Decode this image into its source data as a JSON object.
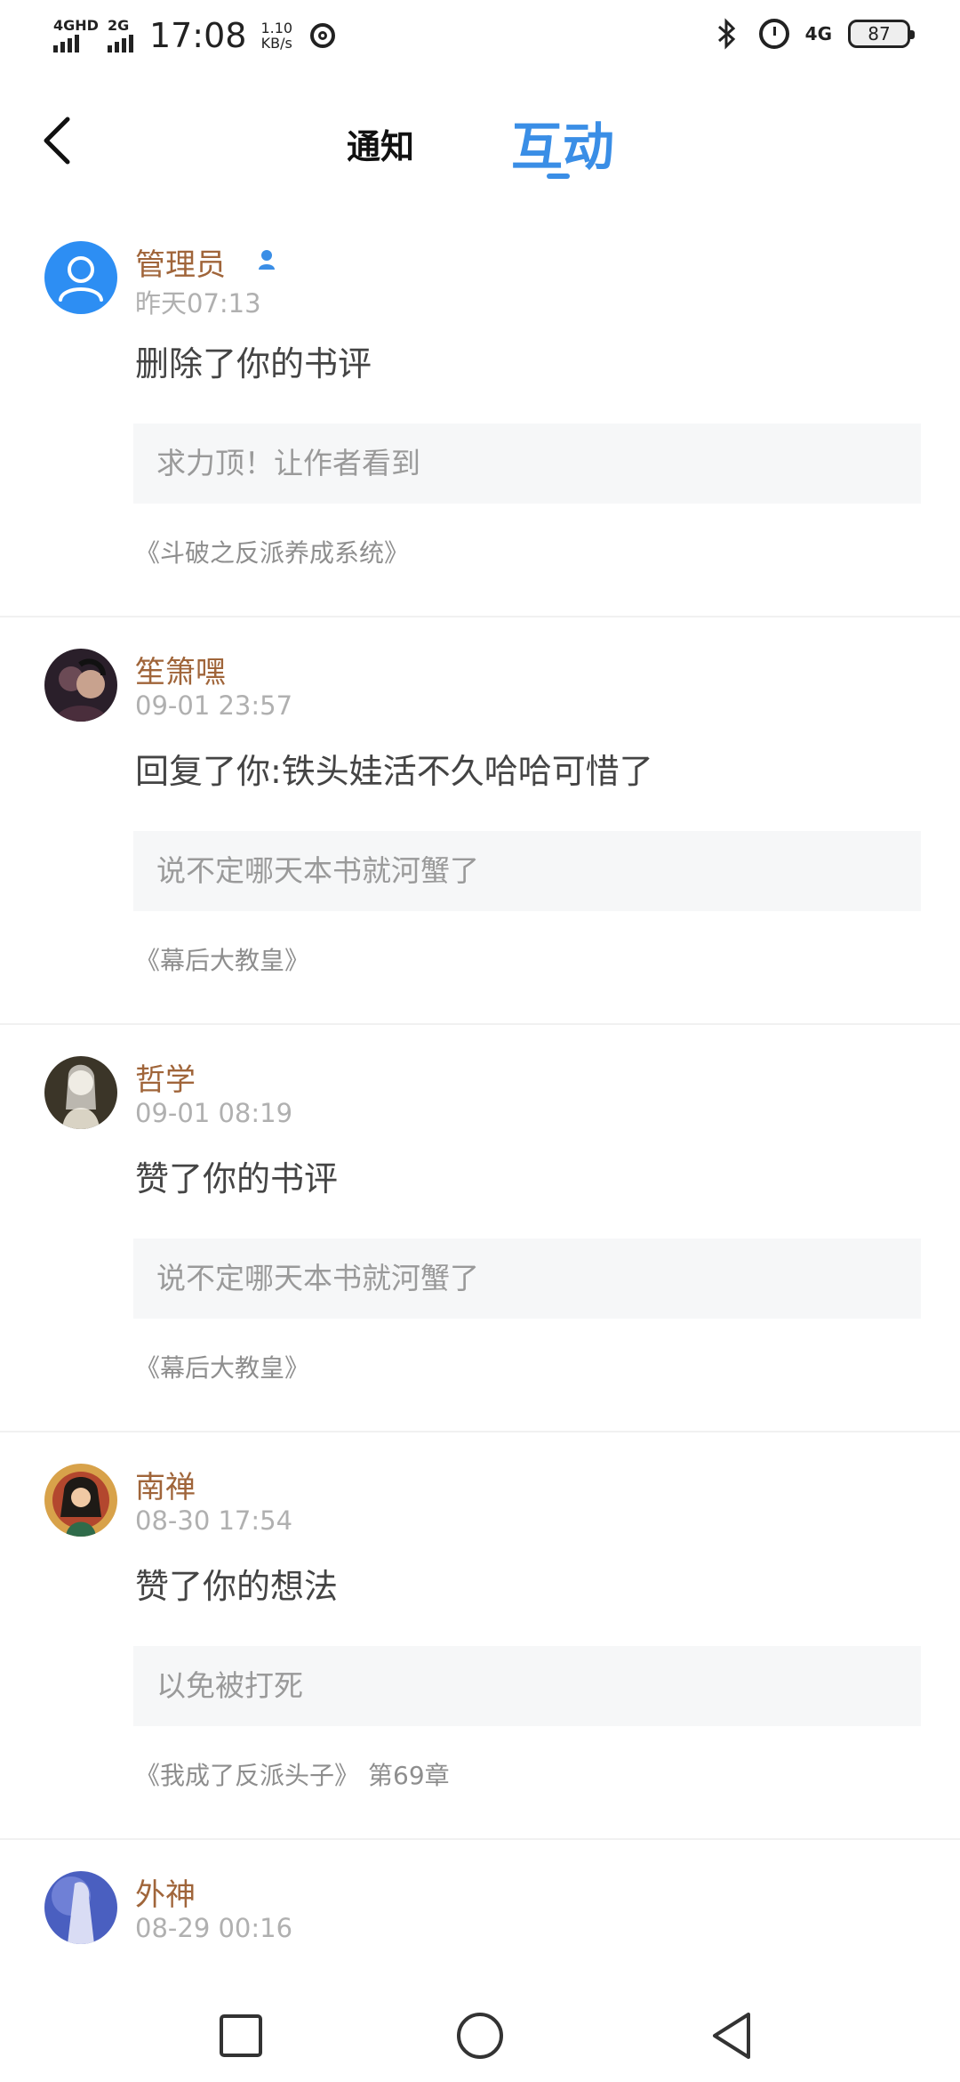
{
  "status_bar": {
    "net_left_1": "4GHD",
    "net_left_2": "2G",
    "time": "17:08",
    "speed_value": "1.10",
    "speed_unit": "KB/s",
    "net_right": "4G",
    "battery": "87",
    "icons": [
      "signal-icon",
      "app-notification-icon",
      "bluetooth-icon",
      "alarm-icon",
      "battery-icon"
    ]
  },
  "header": {
    "back_icon": "chevron-left-icon",
    "tab_notify": "通知",
    "tab_interact": "互动",
    "active_tab": "互动",
    "accent_color": "#3a8ee6"
  },
  "feed": [
    {
      "username": "管理员",
      "verified": true,
      "time": "昨天07:13",
      "action": "删除了你的书评",
      "quote": "求力顶！让作者看到",
      "book": "《斗破之反派养成系统》",
      "chapter": ""
    },
    {
      "username": "笙箫嘿",
      "verified": false,
      "time": "09-01 23:57",
      "action": "回复了你:铁头娃活不久哈哈可惜了",
      "quote": "说不定哪天本书就河蟹了",
      "book": "《幕后大教皇》",
      "chapter": ""
    },
    {
      "username": "哲学",
      "verified": false,
      "time": "09-01 08:19",
      "action": "赞了你的书评",
      "quote": "说不定哪天本书就河蟹了",
      "book": "《幕后大教皇》",
      "chapter": ""
    },
    {
      "username": "南禅",
      "verified": false,
      "time": "08-30 17:54",
      "action": "赞了你的想法",
      "quote": "以免被打死",
      "book": "《我成了反派头子》",
      "chapter": "第69章"
    },
    {
      "username": "外神",
      "verified": false,
      "time": "08-29 00:16"
    }
  ],
  "nav": {
    "icons": [
      "recent-apps-icon",
      "home-icon",
      "back-icon"
    ]
  }
}
